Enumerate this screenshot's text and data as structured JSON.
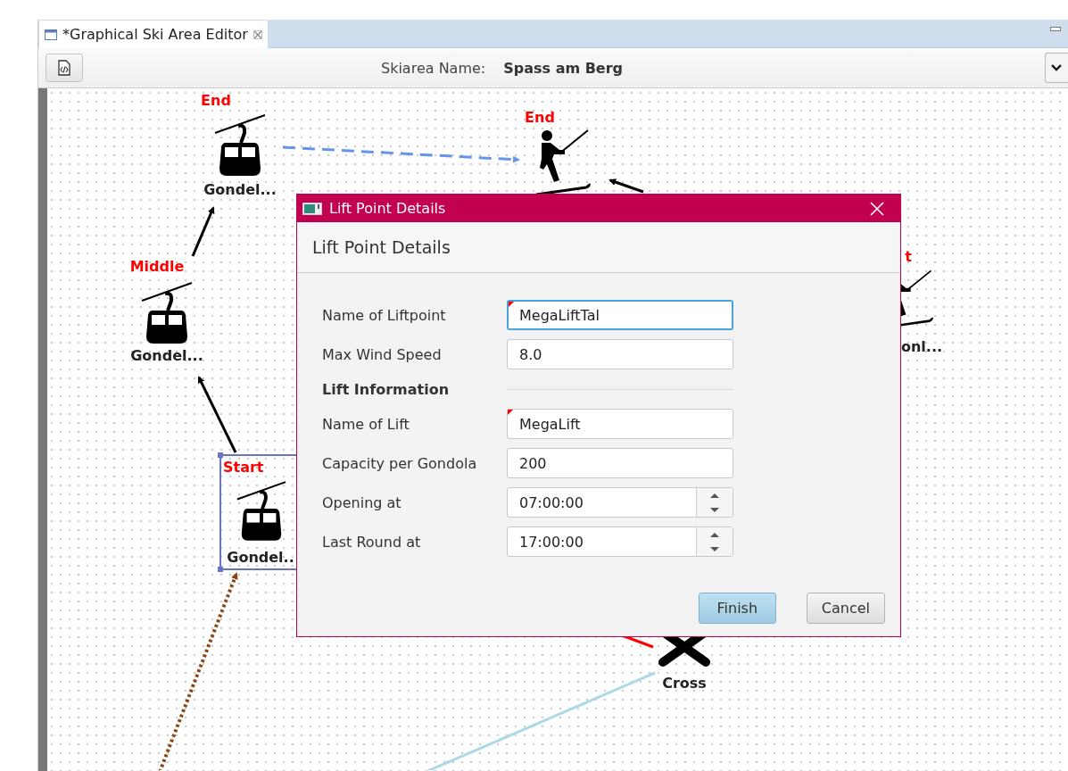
{
  "editor_tab": {
    "title": "*Graphical Ski Area Editor",
    "selected": true
  },
  "toolbar": {
    "label": "Skiarea Name:",
    "value": "Spass am Berg"
  },
  "diagram": {
    "nodes": [
      {
        "kind": "gondola",
        "point": "End",
        "name": "Gondel...",
        "selected": false
      },
      {
        "kind": "skier",
        "point": "End",
        "selected": false
      },
      {
        "kind": "gondola",
        "point": "Middle",
        "name": "Gondel...",
        "selected": false
      },
      {
        "kind": "skier",
        "point": "t",
        "name": "onl...",
        "selected": false
      },
      {
        "kind": "gondola",
        "point": "Start",
        "name": "Gondel..",
        "selected": true
      },
      {
        "kind": "cross",
        "name": "Cross",
        "selected": false
      }
    ],
    "edges": [
      {
        "kind": "arrow",
        "color": "#000000"
      },
      {
        "kind": "arrow",
        "color": "#000000"
      },
      {
        "kind": "dashed-arrow",
        "color": "#6495ed"
      },
      {
        "kind": "arrow",
        "color": "#000000"
      },
      {
        "kind": "dotted-arrow",
        "color": "#8b4513"
      },
      {
        "kind": "line",
        "color": "#ff0000"
      },
      {
        "kind": "line",
        "color": "#add8e6"
      }
    ]
  },
  "dialog": {
    "title": "Lift Point Details",
    "header": "Lift Point Details",
    "rows": [
      {
        "kind": "text",
        "label": "Name of Liftpoint",
        "value": "MegaLiftTal",
        "focused": true,
        "required": true
      },
      {
        "kind": "text",
        "label": "Max Wind Speed",
        "value": "8.0",
        "focused": false,
        "required": false
      },
      {
        "kind": "section",
        "label": "Lift Information"
      },
      {
        "kind": "text",
        "label": "Name of Lift",
        "value": "MegaLift",
        "focused": false,
        "required": true
      },
      {
        "kind": "text",
        "label": "Capacity per Gondola",
        "value": "200",
        "focused": false,
        "required": false
      },
      {
        "kind": "spinner",
        "label": "Opening at",
        "value": "07:00:00",
        "focused": false,
        "required": false
      },
      {
        "kind": "spinner",
        "label": "Last Round at",
        "value": "17:00:00",
        "focused": false,
        "required": false
      }
    ],
    "buttons": [
      {
        "label": "Finish",
        "default": true
      },
      {
        "label": "Cancel",
        "default": false
      }
    ]
  }
}
